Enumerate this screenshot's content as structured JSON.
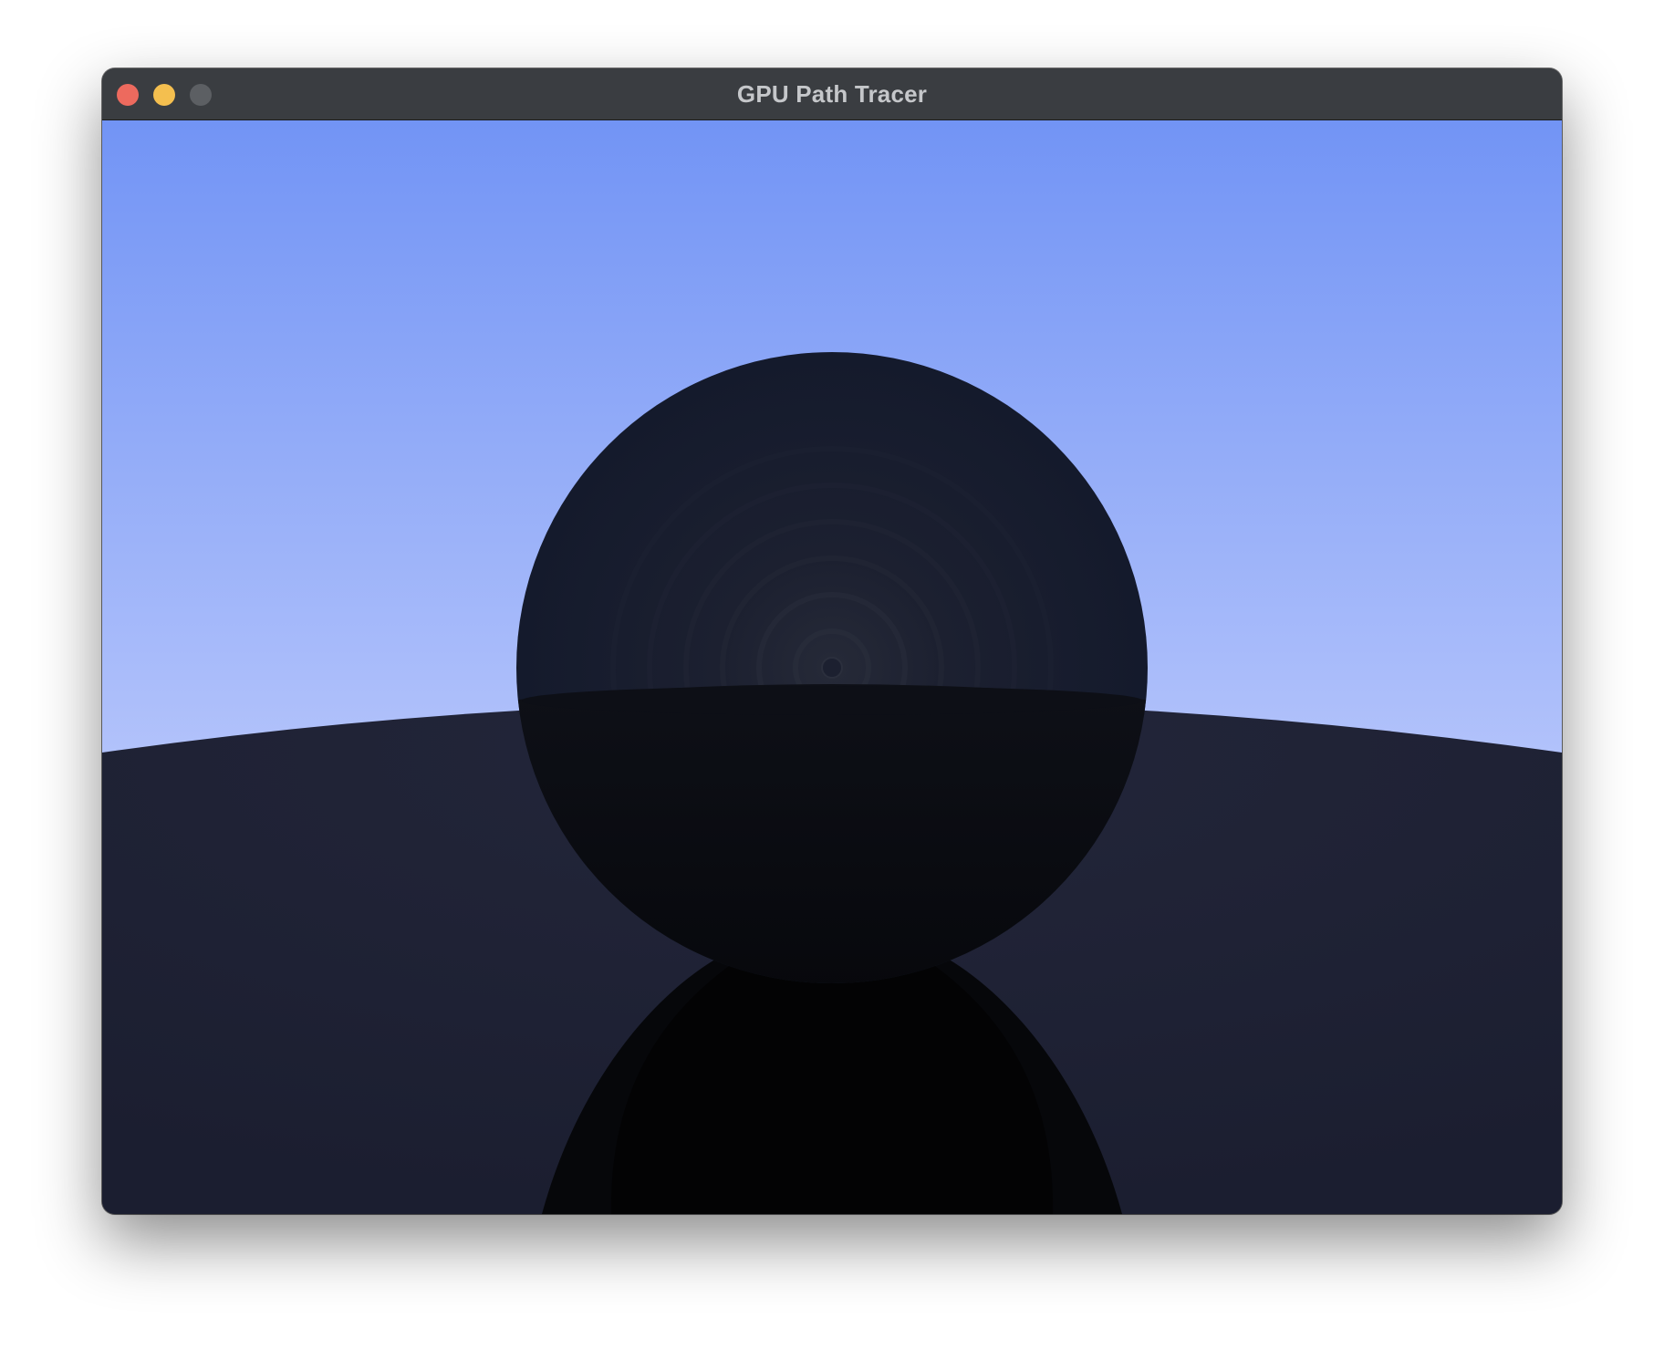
{
  "window": {
    "title": "GPU Path Tracer",
    "controls": [
      {
        "name": "close",
        "color": "#ed6a5e"
      },
      {
        "name": "minimize",
        "color": "#f4bf4f"
      },
      {
        "name": "zoom",
        "color": "#5c5f63"
      }
    ]
  },
  "scene": {
    "sky_top": "#7294f5",
    "sky_horizon": "#b3c3fb",
    "ground_color": "#1f2232",
    "sphere_color": "#141a2c",
    "sphere_lower_color": "#0a0c12",
    "reflection_color": "#030304"
  }
}
